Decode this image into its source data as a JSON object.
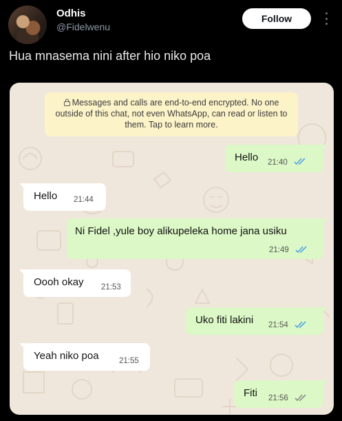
{
  "post": {
    "author_name": "Odhis",
    "author_handle": "@Fidelwenu",
    "follow_label": "Follow",
    "text": "Hua mnasema nini after hio niko poa"
  },
  "chat": {
    "encryption_notice": "Messages and calls are end-to-end encrypted. No one outside of this chat, not even WhatsApp, can read or listen to them. Tap to learn more.",
    "messages": [
      {
        "direction": "out",
        "text": "Hello",
        "time": "21:40",
        "status": "read"
      },
      {
        "direction": "in",
        "text": "Hello",
        "time": "21:44"
      },
      {
        "direction": "out",
        "text": "Ni  Fidel ,yule boy alikupeleka home jana usiku",
        "time": "21:49",
        "status": "read"
      },
      {
        "direction": "in",
        "text": "Oooh okay",
        "time": "21:53"
      },
      {
        "direction": "out",
        "text": "Uko fiti lakini",
        "time": "21:54",
        "status": "read"
      },
      {
        "direction": "in",
        "text": "Yeah niko poa",
        "time": "21:55"
      },
      {
        "direction": "out",
        "text": "Fiti",
        "time": "21:56",
        "status": "delivered"
      }
    ]
  },
  "colors": {
    "read_ticks": "#4fa3e6",
    "delivered_ticks": "#8a8a8a",
    "outgoing_bubble": "#dcf8c6",
    "incoming_bubble": "#ffffff",
    "chat_background": "#efe6dc",
    "notice_background": "#fdf3c8"
  }
}
